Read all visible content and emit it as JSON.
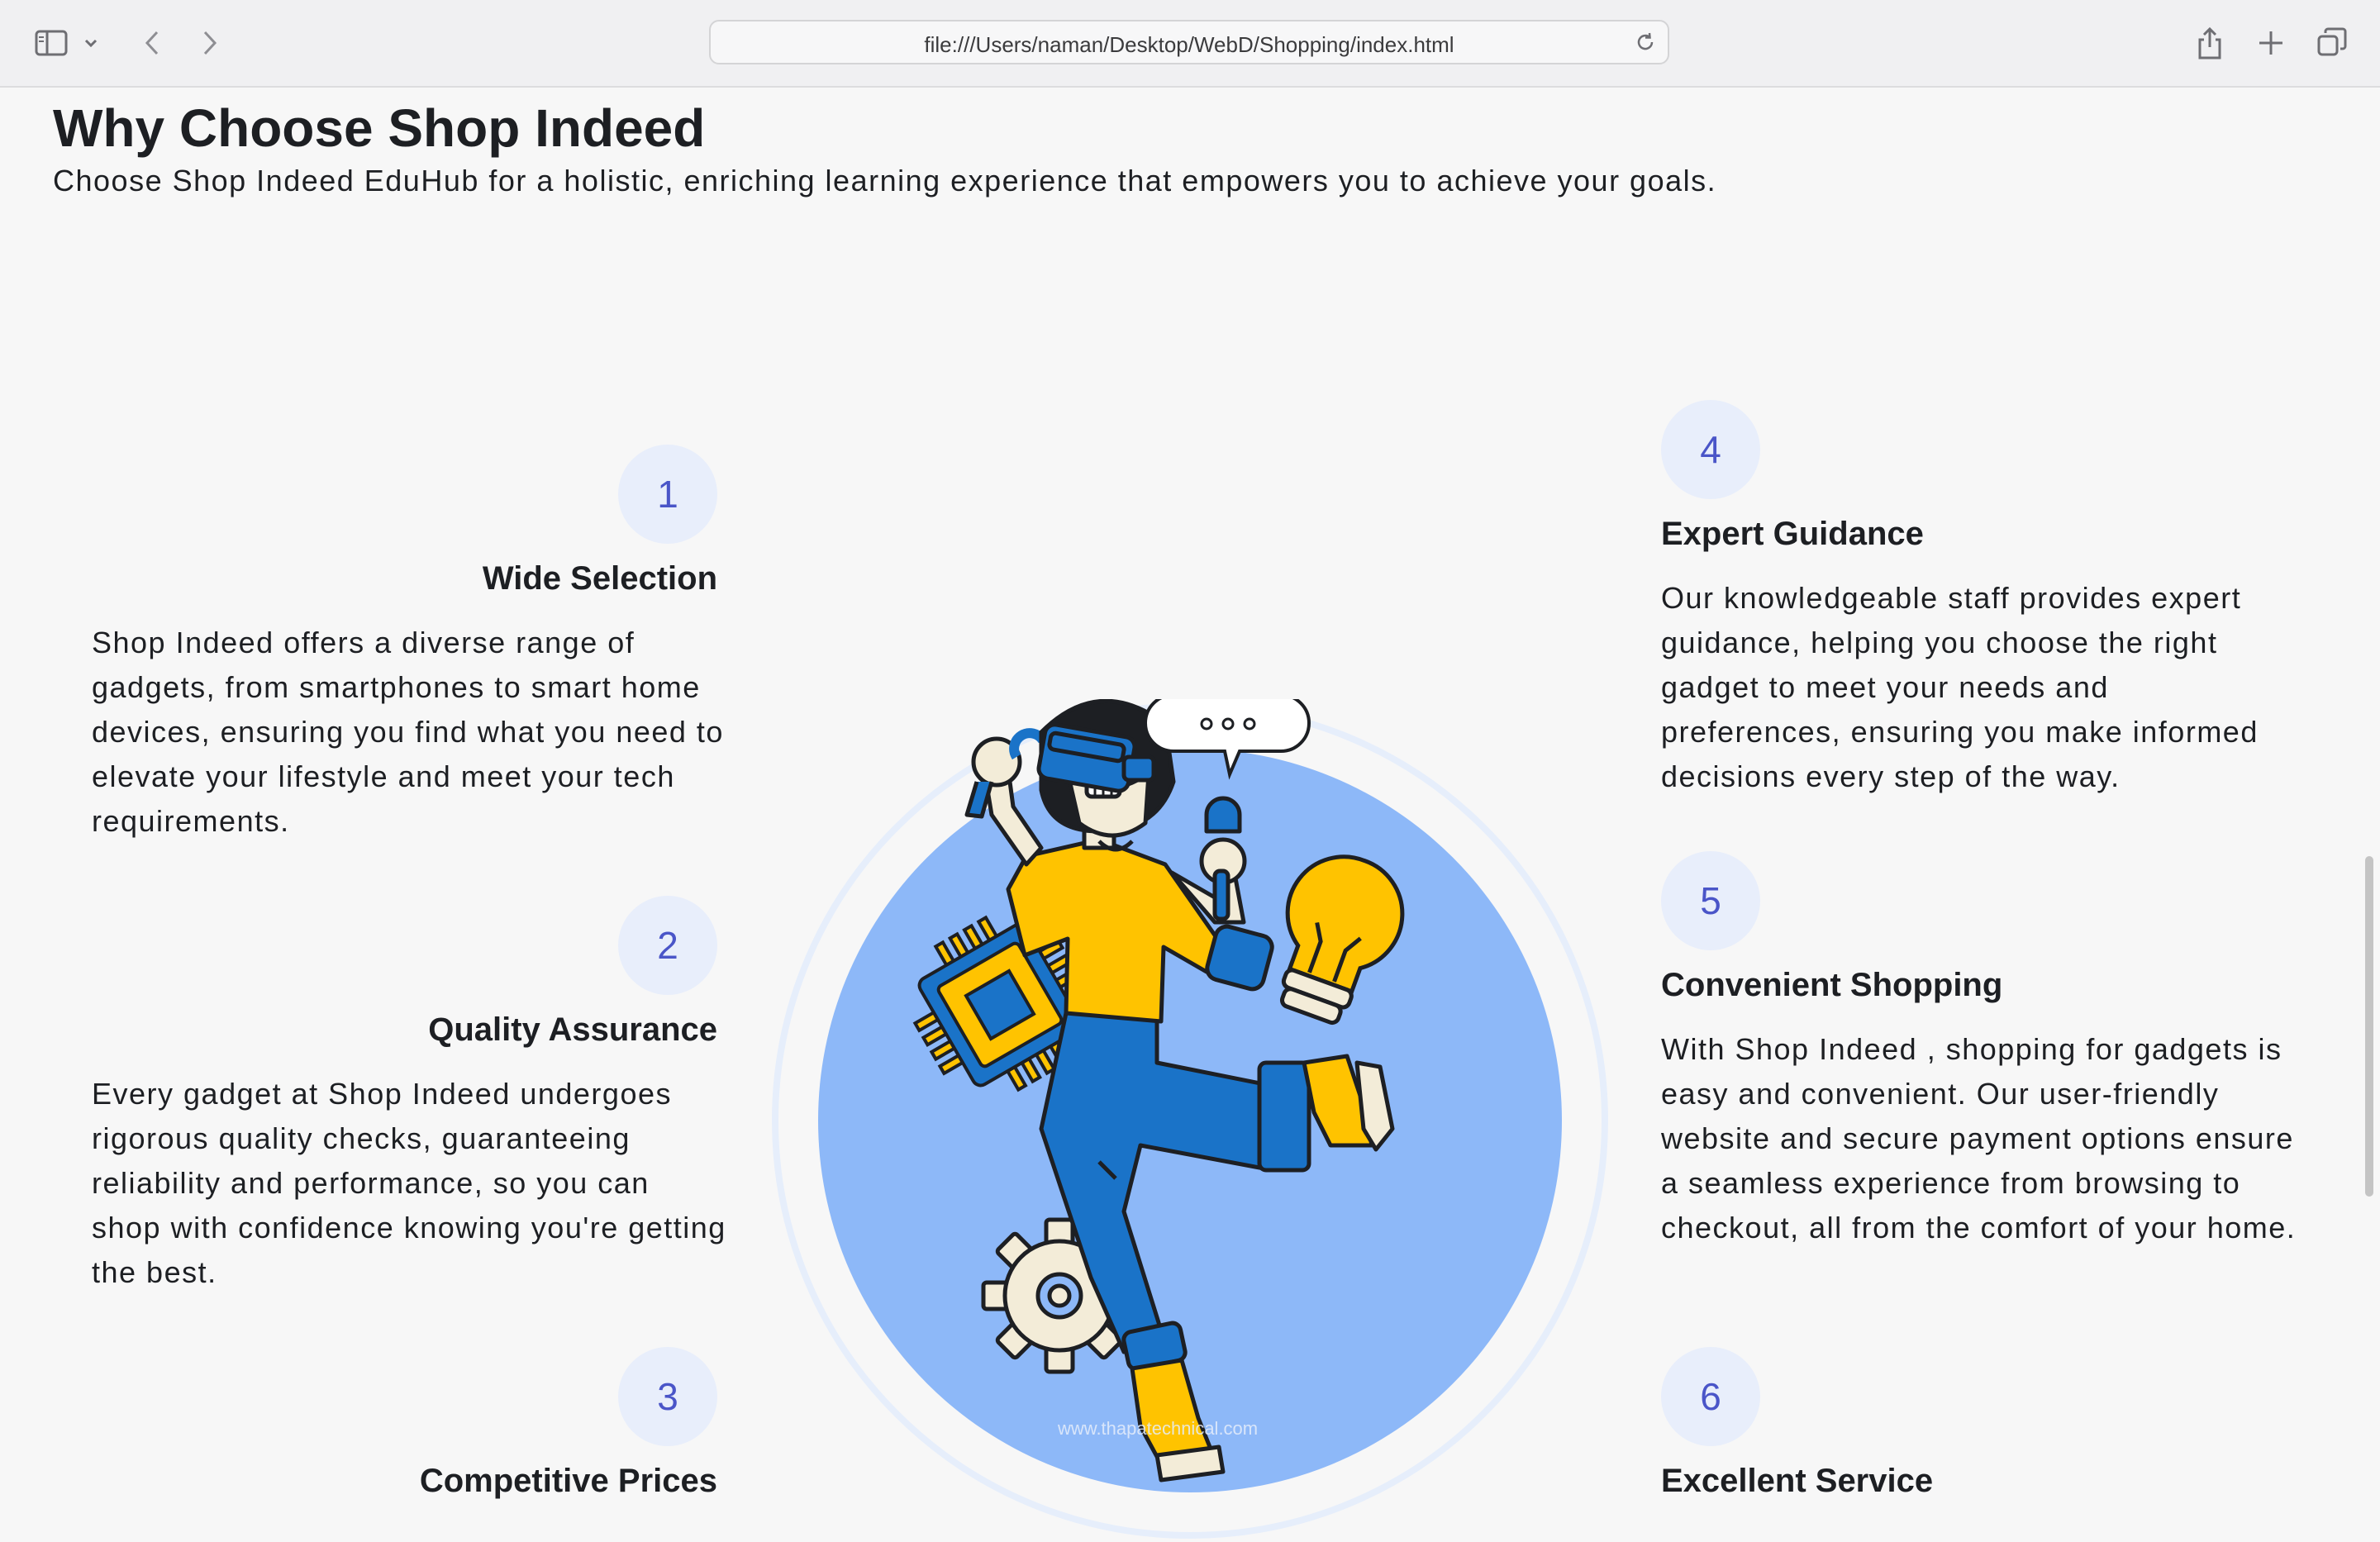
{
  "browser": {
    "url": "file:///Users/naman/Desktop/WebD/Shopping/index.html"
  },
  "section": {
    "title": "Why Choose Shop Indeed",
    "subtitle": "Choose Shop Indeed EduHub for a holistic, enriching learning experience that empowers you to achieve your goals."
  },
  "features": [
    {
      "number": "1",
      "title": "Wide Selection",
      "text": "Shop Indeed offers a diverse range of gadgets, from smartphones to smart home devices, ensuring you find what you need to elevate your lifestyle and meet your tech requirements."
    },
    {
      "number": "2",
      "title": "Quality Assurance",
      "text": "Every gadget at Shop Indeed undergoes rigorous quality checks, guaranteeing reliability and performance, so you can shop with confidence knowing you're getting the best."
    },
    {
      "number": "3",
      "title": "Competitive Prices"
    },
    {
      "number": "4",
      "title": "Expert Guidance",
      "text": "Our knowledgeable staff provides expert guidance, helping you choose the right gadget to meet your needs and preferences, ensuring you make informed decisions every step of the way."
    },
    {
      "number": "5",
      "title": "Convenient Shopping",
      "text": "With Shop Indeed , shopping for gadgets is easy and convenient. Our user-friendly website and secure payment options ensure a seamless experience from browsing to checkout, all from the comfort of your home."
    },
    {
      "number": "6",
      "title": "Excellent Service"
    }
  ],
  "illustration": {
    "watermark": "www.thapatechnical.com"
  },
  "colors": {
    "accent": "#4a55c8",
    "number_bg": "#e8eefb",
    "circle": "#8db8f8",
    "shirt": "#ffc300",
    "jeans": "#1a73c8"
  }
}
